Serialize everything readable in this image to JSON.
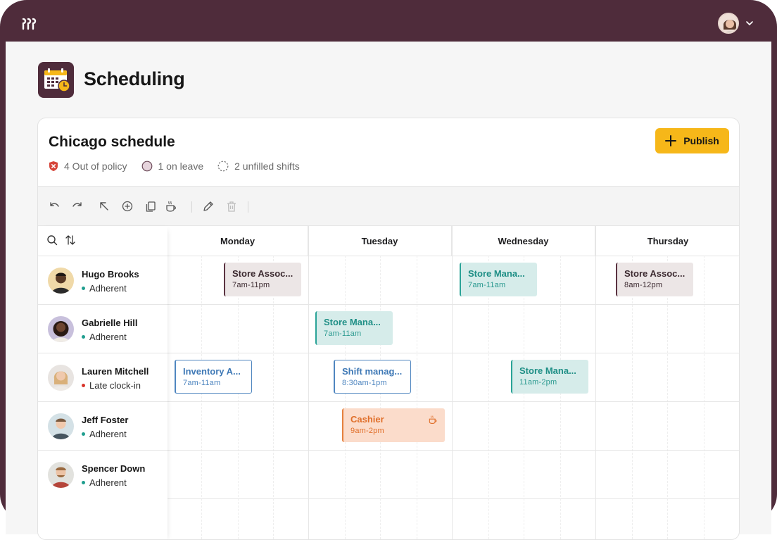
{
  "app": {
    "title": "Scheduling"
  },
  "schedule": {
    "title": "Chicago schedule",
    "stats": {
      "out_of_policy": "4 Out of policy",
      "on_leave": "1 on leave",
      "unfilled": "2 unfilled shifts"
    },
    "publish_label": "Publish"
  },
  "days": [
    "Monday",
    "Tuesday",
    "Wednesday",
    "Thursday"
  ],
  "employees": [
    {
      "name": "Hugo Brooks",
      "status": "Adherent",
      "status_color": "#1f9e8f"
    },
    {
      "name": "Gabrielle Hill",
      "status": "Adherent",
      "status_color": "#1f9e8f"
    },
    {
      "name": "Lauren Mitchell",
      "status": "Late clock-in",
      "status_color": "#d8342b"
    },
    {
      "name": "Jeff Foster",
      "status": "Adherent",
      "status_color": "#1f9e8f"
    },
    {
      "name": "Spencer Down",
      "status": "Adherent",
      "status_color": "#1f9e8f"
    }
  ],
  "shifts": [
    {
      "title": "Store Assoc...",
      "time": "7am-11pm",
      "style": "plum"
    },
    {
      "title": "Store Mana...",
      "time": "7am-11am",
      "style": "teal"
    },
    {
      "title": "Store Assoc...",
      "time": "8am-12pm",
      "style": "plum"
    },
    {
      "title": "Store Mana...",
      "time": "7am-11am",
      "style": "teal"
    },
    {
      "title": "Inventory A...",
      "time": "7am-11am",
      "style": "blue"
    },
    {
      "title": "Shift manag...",
      "time": "8:30am-1pm",
      "style": "blue"
    },
    {
      "title": "Store Mana...",
      "time": "11am-2pm",
      "style": "teal"
    },
    {
      "title": "Cashier",
      "time": "9am-2pm",
      "style": "orange",
      "icon": "coffee-break-icon"
    }
  ],
  "colors": {
    "brand": "#4f2c3b",
    "publish": "#f6b719",
    "teal": "#2aa397",
    "blue": "#4f86c0",
    "orange": "#e5803d"
  },
  "icons": [
    "logo-icon",
    "calendar-icon",
    "clock-icon",
    "chevron-down-icon",
    "shield-x-icon",
    "leave-circle-icon",
    "dashed-circle-icon",
    "plus-icon",
    "undo-icon",
    "redo-icon",
    "cursor-icon",
    "add-circle-icon",
    "copy-icon",
    "coffee-break-icon",
    "pencil-icon",
    "trash-icon",
    "search-icon",
    "sort-icon"
  ]
}
